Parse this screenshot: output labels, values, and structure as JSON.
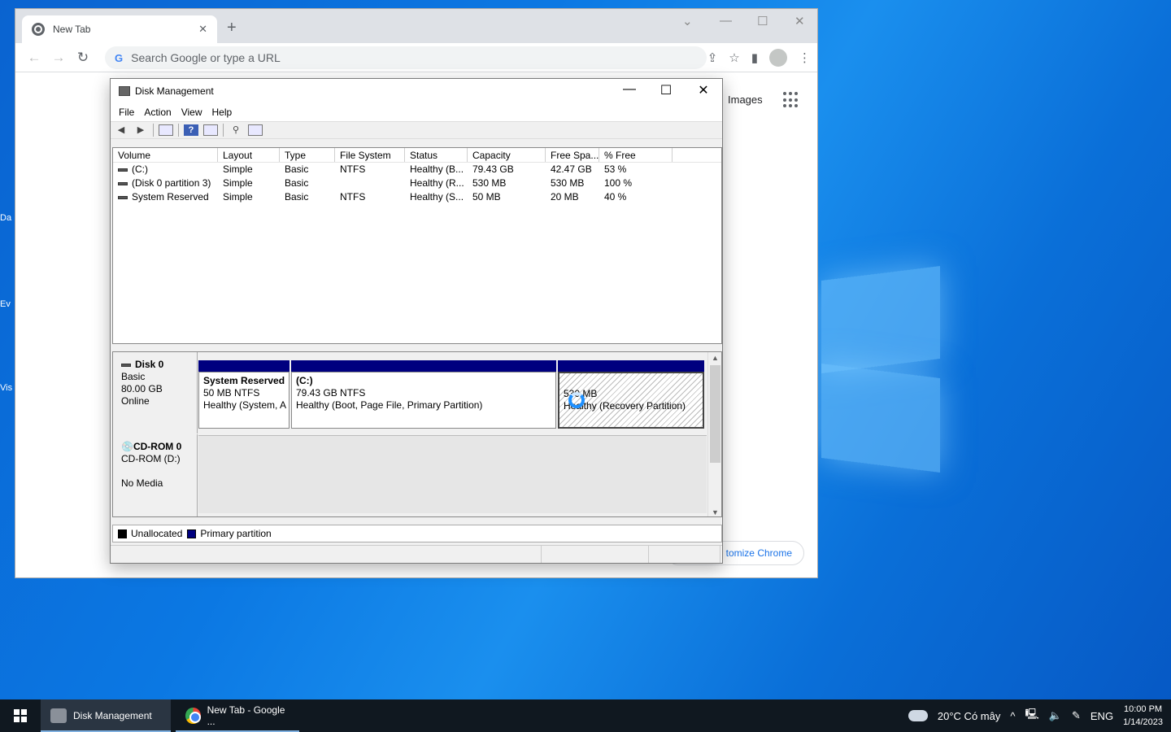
{
  "desktop": {
    "icons": [
      {
        "label": "Da"
      },
      {
        "label": "Ev"
      },
      {
        "label": "Vis"
      }
    ]
  },
  "chrome": {
    "tab_title": "New Tab",
    "omnibox_placeholder": "Search Google or type a URL",
    "ntp_images_link": "Images",
    "customize_label": "tomize Chrome"
  },
  "disk_management": {
    "title": "Disk Management",
    "menu": [
      "File",
      "Action",
      "View",
      "Help"
    ],
    "columns": [
      "Volume",
      "Layout",
      "Type",
      "File System",
      "Status",
      "Capacity",
      "Free Spa...",
      "% Free"
    ],
    "volumes": [
      {
        "volume": "(C:)",
        "layout": "Simple",
        "type": "Basic",
        "fs": "NTFS",
        "status": "Healthy (B...",
        "capacity": "79.43 GB",
        "free": "42.47 GB",
        "pct": "53 %"
      },
      {
        "volume": "(Disk 0 partition 3)",
        "layout": "Simple",
        "type": "Basic",
        "fs": "",
        "status": "Healthy (R...",
        "capacity": "530 MB",
        "free": "530 MB",
        "pct": "100 %"
      },
      {
        "volume": "System Reserved",
        "layout": "Simple",
        "type": "Basic",
        "fs": "NTFS",
        "status": "Healthy (S...",
        "capacity": "50 MB",
        "free": "20 MB",
        "pct": "40 %"
      }
    ],
    "disk0": {
      "name": "Disk 0",
      "kind": "Basic",
      "size": "80.00 GB",
      "state": "Online",
      "partitions": [
        {
          "title": "System Reserved",
          "line1": "50 MB NTFS",
          "line2": "Healthy (System, A"
        },
        {
          "title": "(C:)",
          "line1": "79.43 GB NTFS",
          "line2": "Healthy (Boot, Page File, Primary Partition)"
        },
        {
          "title": "",
          "line1": "530 MB",
          "line2": "Healthy (Recovery Partition)"
        }
      ]
    },
    "cdrom": {
      "name": "CD-ROM 0",
      "drive": "CD-ROM (D:)",
      "media": "No Media"
    },
    "legend": [
      {
        "label": "Unallocated",
        "color": "#000000"
      },
      {
        "label": "Primary partition",
        "color": "#00007f"
      }
    ]
  },
  "taskbar": {
    "items": [
      {
        "label": "Disk Management"
      },
      {
        "label": "New Tab - Google ..."
      }
    ],
    "weather": "20°C  Có mây",
    "language": "ENG",
    "time": "10:00 PM",
    "date": "1/14/2023"
  }
}
